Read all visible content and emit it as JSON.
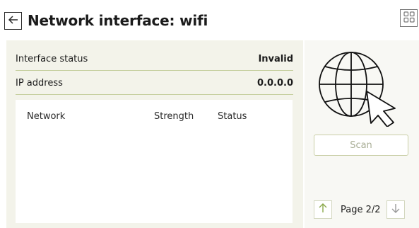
{
  "header": {
    "title": "Network interface: wifi",
    "back_icon": "arrow-left-icon",
    "grid_icon": "grid-icon"
  },
  "info": {
    "status_label": "Interface status",
    "status_value": "Invalid",
    "ip_label": "IP address",
    "ip_value": "0.0.0.0"
  },
  "table": {
    "columns": [
      "Network",
      "Strength",
      "Status"
    ],
    "rows": []
  },
  "actions": {
    "scan_label": "Scan"
  },
  "pager": {
    "label": "Page 2/2",
    "up_icon": "arrow-up-icon",
    "down_icon": "arrow-down-icon"
  },
  "colors": {
    "panel_bg": "#f3f3ea",
    "divider": "#c5cf9e",
    "up_arrow": "#8aa84a"
  }
}
